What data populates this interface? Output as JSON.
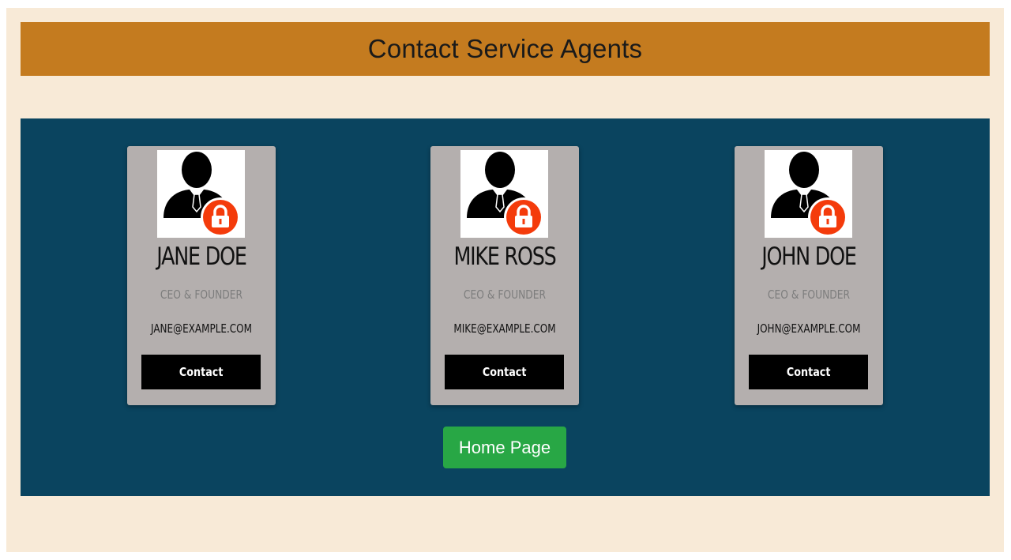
{
  "header": {
    "title": "Contact Service Agents"
  },
  "agents": [
    {
      "name": "JANE DOE",
      "role": "CEO & FOUNDER",
      "email": "JANE@EXAMPLE.COM",
      "contact_label": "Contact",
      "avatar_icon": "user-lock-icon"
    },
    {
      "name": "MIKE ROSS",
      "role": "CEO & FOUNDER",
      "email": "MIKE@EXAMPLE.COM",
      "contact_label": "Contact",
      "avatar_icon": "user-lock-icon"
    },
    {
      "name": "JOHN DOE",
      "role": "CEO & FOUNDER",
      "email": "JOHN@EXAMPLE.COM",
      "contact_label": "Contact",
      "avatar_icon": "user-lock-icon"
    }
  ],
  "home_button": {
    "label": "Home Page"
  },
  "colors": {
    "page_background": "#f8ead7",
    "header_background": "#c47b1f",
    "panel_background": "#0a445f",
    "card_background": "#b4afae",
    "contact_button": "#000000",
    "home_button": "#28a745",
    "lock_badge": "#f43b0b"
  }
}
